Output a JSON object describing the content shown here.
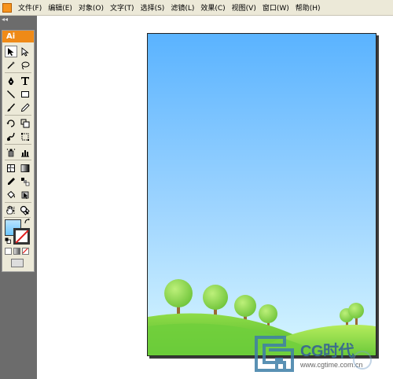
{
  "menubar": {
    "items": [
      "文件(F)",
      "编辑(E)",
      "对象(O)",
      "文字(T)",
      "选择(S)",
      "滤镜(L)",
      "效果(C)",
      "视图(V)",
      "窗口(W)",
      "帮助(H)"
    ]
  },
  "panel": {
    "collapse_glyph": "◂◂",
    "logo": "Ai"
  },
  "tools": [
    {
      "name": "selection-tool",
      "icon": "arrow-black"
    },
    {
      "name": "direct-selection-tool",
      "icon": "arrow-white"
    },
    {
      "name": "magic-wand-tool",
      "icon": "wand"
    },
    {
      "name": "lasso-tool",
      "icon": "lasso"
    },
    {
      "name": "pen-tool",
      "icon": "pen"
    },
    {
      "name": "type-tool",
      "icon": "T"
    },
    {
      "name": "line-tool",
      "icon": "line"
    },
    {
      "name": "rectangle-tool",
      "icon": "rect"
    },
    {
      "name": "paintbrush-tool",
      "icon": "brush"
    },
    {
      "name": "pencil-tool",
      "icon": "pencil"
    },
    {
      "name": "rotate-tool",
      "icon": "rotate"
    },
    {
      "name": "scale-tool",
      "icon": "scale"
    },
    {
      "name": "warp-tool",
      "icon": "warp"
    },
    {
      "name": "free-transform-tool",
      "icon": "transform"
    },
    {
      "name": "symbol-sprayer-tool",
      "icon": "symbol"
    },
    {
      "name": "column-graph-tool",
      "icon": "graph"
    },
    {
      "name": "mesh-tool",
      "icon": "mesh"
    },
    {
      "name": "gradient-tool",
      "icon": "gradient"
    },
    {
      "name": "eyedropper-tool",
      "icon": "eyedropper"
    },
    {
      "name": "blend-tool",
      "icon": "blend"
    },
    {
      "name": "live-paint-bucket-tool",
      "icon": "bucket"
    },
    {
      "name": "live-paint-selection-tool",
      "icon": "paint-select"
    },
    {
      "name": "slice-tool",
      "icon": "slice"
    },
    {
      "name": "eraser-tool",
      "icon": "eraser"
    },
    {
      "name": "hand-tool",
      "icon": "hand"
    },
    {
      "name": "zoom-tool",
      "icon": "zoom"
    }
  ],
  "colors": {
    "fill_top": "#b9e3ff",
    "fill_bottom": "#6cc6ff",
    "stroke": "none",
    "sky_top": "#5ab3ff",
    "sky_bottom": "#d7f6ff",
    "grass": "#6fcf3a",
    "tree_foliage": "#8fd84a",
    "tree_trunk": "#9a6a34"
  },
  "watermark": {
    "brand": "CG时代",
    "url": "www.cgtime.com.cn"
  }
}
